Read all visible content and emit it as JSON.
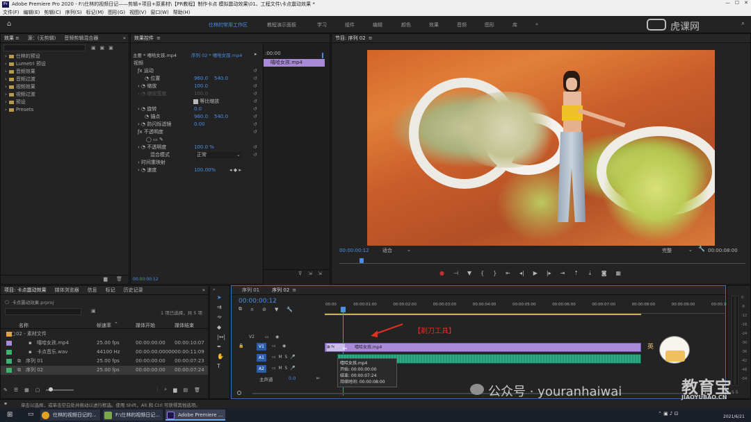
{
  "titlebar": {
    "app": "Adobe Premiere Pro 2020 - F:\\仕林的视频日记——剪辑+项目+原素材\\【PR教程】制作卡点 模拟震动效果\\01、工程文件\\卡点震动效果 *",
    "pr_badge": "Pr"
  },
  "menu": [
    "文件(F)",
    "编辑(E)",
    "剪辑(C)",
    "序列(S)",
    "标记(M)",
    "图形(G)",
    "视图(V)",
    "窗口(W)",
    "帮助(H)"
  ],
  "workspaces": {
    "items": [
      "仕林的常用工作区",
      "教程演示面板",
      "学习",
      "组件",
      "编辑",
      "颜色",
      "效果",
      "音频",
      "图形",
      "库"
    ],
    "active": "仕林的常用工作区",
    "more": "»"
  },
  "watermark_top": "虎课网",
  "effects_panel": {
    "tabs": [
      "效果",
      "源：(无剪辑)",
      "音频剪辑混合器"
    ],
    "tree": [
      "仕林的预设",
      "Lumetri 预设",
      "音频效果",
      "音频过渡",
      "视频效果",
      "视频过渡",
      "预设",
      "Presets"
    ]
  },
  "effect_controls": {
    "tab": "效果控件",
    "source_label": "主要 * 嘻哈女孩.mp4",
    "sequence_label": "序列 02 * 嘻哈女孩.mp4",
    "timecode_header": ":00:00",
    "clip_label": "嘻哈女孩.mp4",
    "section_video": "视频",
    "motion": "运动",
    "position": {
      "label": "位置",
      "x": "960.0",
      "y": "540.0"
    },
    "scale": {
      "label": "缩放",
      "value": "100.0"
    },
    "scale_width": {
      "label": "缩放宽度",
      "value": "100.0"
    },
    "uniform": "等比缩放",
    "rotation": {
      "label": "旋转",
      "value": "0.0"
    },
    "anchor": {
      "label": "锚点",
      "x": "960.0",
      "y": "540.0"
    },
    "antiflicker": {
      "label": "防闪烁滤镜",
      "value": "0.00"
    },
    "opacity_section": "不透明度",
    "opacity": {
      "label": "不透明度",
      "value": "100.0 %"
    },
    "blend": {
      "label": "混合模式",
      "value": "正常"
    },
    "time_remap": "时间重映射",
    "speed": {
      "label": "速度",
      "value": "100.00%"
    },
    "bottom_tc": "00:00:00:12"
  },
  "program_monitor": {
    "tab": "节目: 序列 02",
    "timecode": "00:00:00:12",
    "fit": "适合",
    "quality": "完整",
    "duration": "00:00:08:00"
  },
  "project_panel": {
    "tabs": [
      "项目: 卡点震动效果",
      "媒体浏览器",
      "信息",
      "标记",
      "历史记录"
    ],
    "path": "卡点震动效果.prproj",
    "selection": "1 项已选择，共 5 项",
    "columns": [
      "名称",
      "帧速率",
      "媒体开始",
      "媒体结束"
    ],
    "rows": [
      {
        "name": "02 - 素材文件",
        "fps": "",
        "start": "",
        "end": "",
        "color": "#e8a040"
      },
      {
        "name": "嘻哈女孩.mp4",
        "fps": "25.00 fps",
        "start": "00:00:00:00",
        "end": "00:00:10:07",
        "color": "#a88ad8"
      },
      {
        "name": "卡点音乐.wav",
        "fps": "44100 Hz",
        "start": "00:00:00:00000",
        "end": "00:00:11:09",
        "color": "#40b070"
      },
      {
        "name": "序列 01",
        "fps": "25.00 fps",
        "start": "00:00:00:00",
        "end": "00:00:07:23",
        "color": "#40b070"
      },
      {
        "name": "序列 02",
        "fps": "25.00 fps",
        "start": "00:00:00:00",
        "end": "00:00:07:24",
        "color": "#40b070"
      }
    ]
  },
  "timeline": {
    "tabs": [
      "序列 01",
      "序列 02"
    ],
    "timecode": "00:00:00:12",
    "ruler": [
      "00:00",
      "00:00:01:00",
      "00:00:02:00",
      "00:00:03:00",
      "00:00:04:00",
      "00:00:05:00",
      "00:00:06:00",
      "00:00:07:00",
      "00:00:08:00",
      "00:00:09:00",
      "00:00:10:00"
    ],
    "tracks": [
      "V2",
      "V1",
      "A1",
      "A2"
    ],
    "master": "主声道",
    "master_val": "0.0",
    "clip_video": "嘻哈女孩.mp4",
    "annotation": "【剃刀工具】",
    "tooltip": {
      "name": "嘻哈女孩.mp4",
      "start": "开始: 00:00:00:00",
      "end": "结束: 00:00:07:24",
      "duration": "持续时间: 00:00:08:00"
    },
    "meters": [
      "0",
      "-6",
      "-12",
      "-18",
      "-24",
      "-30",
      "-36",
      "-42",
      "-48",
      "-54"
    ],
    "meter_labels": [
      "S",
      "S"
    ]
  },
  "statusbar": "单击以选择，或单击空白处并拖动以进行框选。使用 Shift，Alt 和 Ctrl 可获得其他选项。",
  "watermark_bottom": "公众号 · youranhaiwai",
  "watermark_brand": "教育宝",
  "watermark_brand_sub": "JIAOYUBAO.CN",
  "mascot_text": "英",
  "taskbar": {
    "items": [
      "仕林的视频日记的...",
      "F:\\仕林的视频日记...",
      "Adobe Premiere ..."
    ],
    "date": "2021/6/21"
  },
  "colors": {
    "accent": "#4a8fe7",
    "clip_video": "#a88ad8",
    "clip_audio": "#1f8a6a",
    "annotation": "#e03020"
  }
}
